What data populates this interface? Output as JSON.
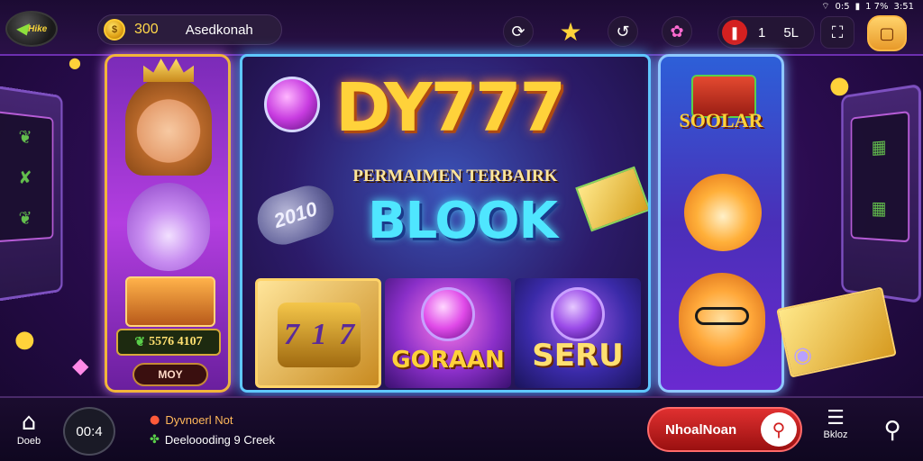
{
  "status_bar": {
    "left": "0:5",
    "battery": "1 7%",
    "time": "3:51"
  },
  "header": {
    "back_label": "Hike",
    "coins": "300",
    "username": "Asedkonah",
    "lives": "1",
    "level": "5L"
  },
  "left_panel": {
    "score": "5576 4107",
    "button_label": "MOY"
  },
  "center_panel": {
    "brand": "DY777",
    "tagline": "PERMAIMEN TERBAIRK",
    "headline": "BLOOK",
    "badge": "2010",
    "tiles": [
      {
        "label": "",
        "digits": [
          "7",
          "1",
          "7"
        ]
      },
      {
        "label": "GORAAN"
      },
      {
        "label": "SERU"
      }
    ]
  },
  "right_panel": {
    "label": "SOOLAR"
  },
  "footer": {
    "home_label": "Doeb",
    "timer": "00:4",
    "news_line1": "Dyvnoerl Not",
    "news_line2": "Deeloooding 9 Creek",
    "action_label": "NhoalNoan",
    "list_label": "Bkloz"
  },
  "colors": {
    "accent_gold": "#ffd23a",
    "accent_purple": "#b33ee0",
    "accent_blue": "#5fc8ff",
    "action_red": "#e03030"
  }
}
